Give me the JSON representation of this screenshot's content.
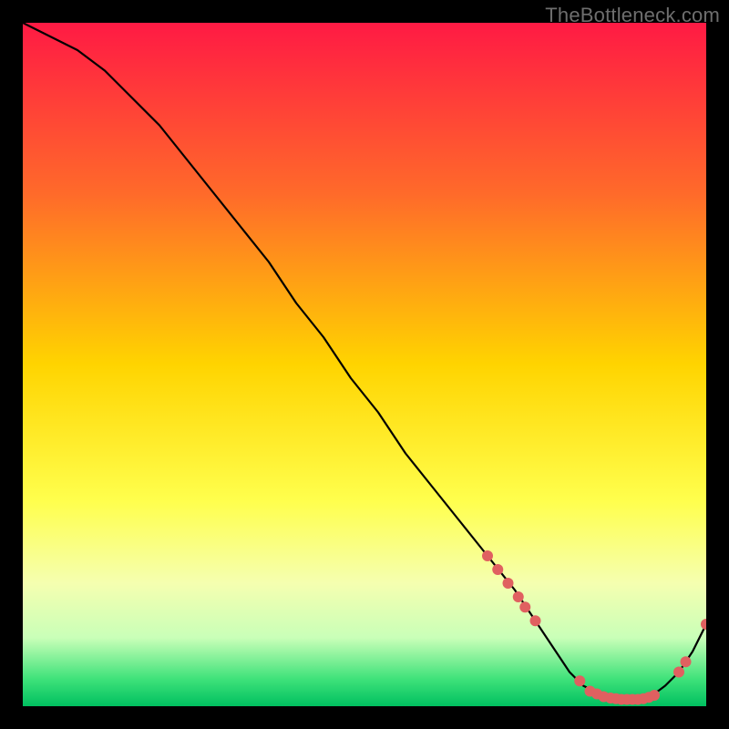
{
  "watermark": "TheBottleneck.com",
  "chart_data": {
    "type": "line",
    "title": "",
    "xlabel": "",
    "ylabel": "",
    "xlim": [
      0,
      100
    ],
    "ylim": [
      0,
      100
    ],
    "grid": false,
    "legend": false,
    "background_gradient": {
      "stops": [
        {
          "pos": 0.0,
          "color": "#ff1a44"
        },
        {
          "pos": 0.25,
          "color": "#ff6a2a"
        },
        {
          "pos": 0.5,
          "color": "#ffd400"
        },
        {
          "pos": 0.7,
          "color": "#ffff4d"
        },
        {
          "pos": 0.82,
          "color": "#f5ffb0"
        },
        {
          "pos": 0.9,
          "color": "#c9ffb8"
        },
        {
          "pos": 0.96,
          "color": "#3fe27a"
        },
        {
          "pos": 1.0,
          "color": "#00c060"
        }
      ]
    },
    "series": [
      {
        "name": "curve",
        "color": "#000000",
        "x": [
          0,
          4,
          8,
          12,
          16,
          20,
          24,
          28,
          32,
          36,
          40,
          44,
          48,
          52,
          56,
          60,
          64,
          68,
          72,
          74,
          76,
          78,
          80,
          82,
          84,
          86,
          88,
          90,
          92,
          94,
          96,
          98,
          100
        ],
        "y": [
          100,
          98,
          96,
          93,
          89,
          85,
          80,
          75,
          70,
          65,
          59,
          54,
          48,
          43,
          37,
          32,
          27,
          22,
          17,
          14,
          11,
          8,
          5,
          3,
          2,
          1.2,
          1,
          1,
          1.5,
          3,
          5,
          8,
          12
        ]
      }
    ],
    "markers": {
      "name": "highlight-points",
      "color": "#e06060",
      "radius": 6,
      "points": [
        {
          "x": 68.0,
          "y": 22.0
        },
        {
          "x": 69.5,
          "y": 20.0
        },
        {
          "x": 71.0,
          "y": 18.0
        },
        {
          "x": 72.5,
          "y": 16.0
        },
        {
          "x": 73.5,
          "y": 14.5
        },
        {
          "x": 75.0,
          "y": 12.5
        },
        {
          "x": 81.5,
          "y": 3.7
        },
        {
          "x": 83.0,
          "y": 2.2
        },
        {
          "x": 84.0,
          "y": 1.8
        },
        {
          "x": 85.0,
          "y": 1.4
        },
        {
          "x": 86.0,
          "y": 1.2
        },
        {
          "x": 86.8,
          "y": 1.1
        },
        {
          "x": 87.6,
          "y": 1.0
        },
        {
          "x": 88.4,
          "y": 1.0
        },
        {
          "x": 89.2,
          "y": 1.0
        },
        {
          "x": 90.0,
          "y": 1.0
        },
        {
          "x": 90.8,
          "y": 1.1
        },
        {
          "x": 91.6,
          "y": 1.3
        },
        {
          "x": 92.4,
          "y": 1.6
        },
        {
          "x": 96.0,
          "y": 5.0
        },
        {
          "x": 97.0,
          "y": 6.5
        },
        {
          "x": 100.0,
          "y": 12.0
        }
      ]
    }
  }
}
